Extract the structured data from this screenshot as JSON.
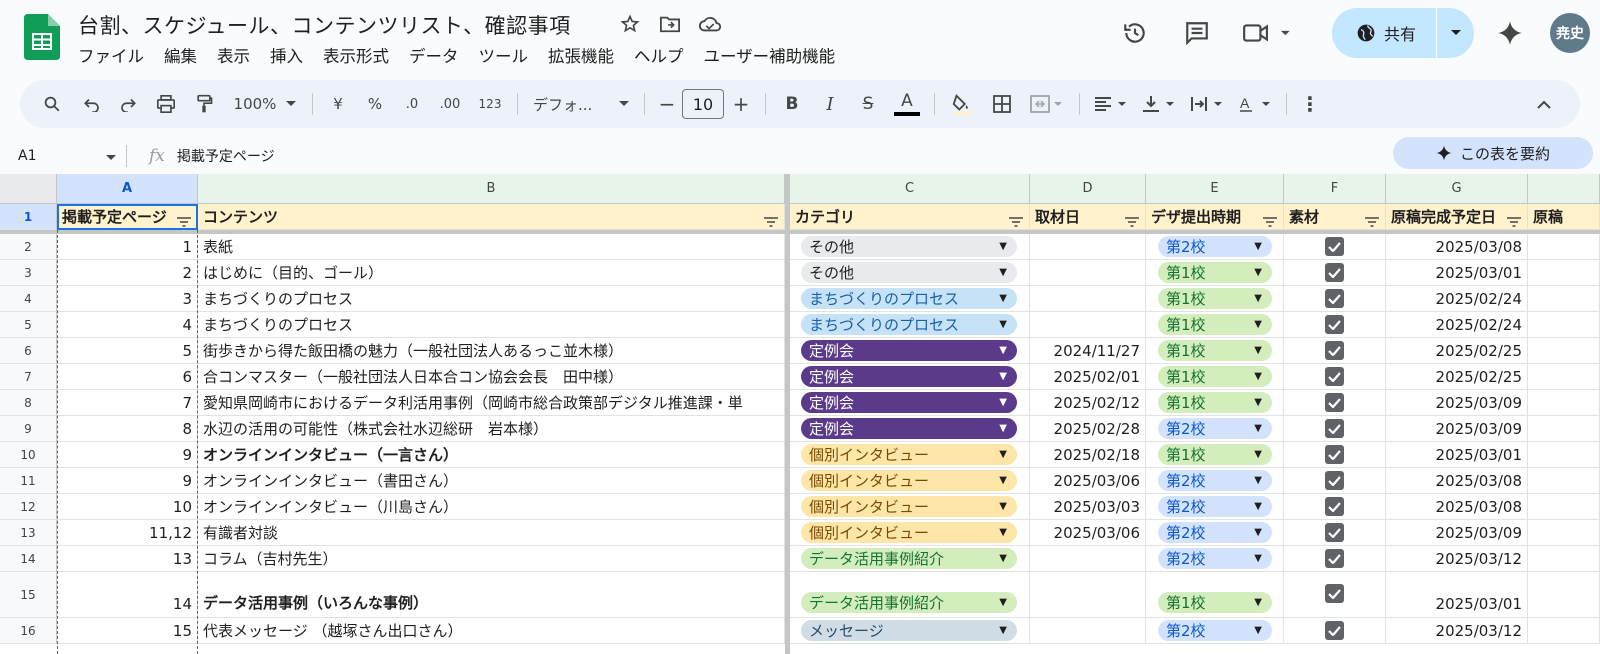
{
  "doc": {
    "title": "台割、スケジュール、コンテンツリスト、確認事項"
  },
  "menu": [
    "ファイル",
    "編集",
    "表示",
    "挿入",
    "表示形式",
    "データ",
    "ツール",
    "拡張機能",
    "ヘルプ",
    "ユーザー補助機能"
  ],
  "header_actions": {
    "share_label": "共有",
    "avatar_initials": "尭史"
  },
  "toolbar": {
    "zoom": "100%",
    "currency": "¥",
    "percent": "%",
    "dec_decrease": ".0",
    "dec_increase": ".00",
    "number_format": "123",
    "font": "デフォ...",
    "font_size": "10"
  },
  "formula_bar": {
    "cell_ref": "A1",
    "content": "掲載予定ページ",
    "summarize_label": "この表を要約"
  },
  "columns": [
    "A",
    "B",
    "C",
    "D",
    "E",
    "F",
    "G"
  ],
  "header_row": {
    "row_num": "1",
    "a": "掲載予定ページ",
    "b": "コンテンツ",
    "c": "カテゴリ",
    "d": "取材日",
    "e": "デザ提出時期",
    "f": "素材",
    "g": "原稿完成予定日",
    "h": "原稿"
  },
  "rows": [
    {
      "n": "2",
      "a": "1",
      "b": "表紙",
      "c": "その他",
      "d": "",
      "e": "第2校",
      "f": true,
      "g": "2025/03/08"
    },
    {
      "n": "3",
      "a": "2",
      "b": "はじめに（目的、ゴール）",
      "c": "その他",
      "d": "",
      "e": "第1校",
      "f": true,
      "g": "2025/03/01"
    },
    {
      "n": "4",
      "a": "3",
      "b": "まちづくりのプロセス",
      "c": "まちづくりのプロセス",
      "d": "",
      "e": "第1校",
      "f": true,
      "g": "2025/02/24"
    },
    {
      "n": "5",
      "a": "4",
      "b": "まちづくりのプロセス",
      "c": "まちづくりのプロセス",
      "d": "",
      "e": "第1校",
      "f": true,
      "g": "2025/02/24"
    },
    {
      "n": "6",
      "a": "5",
      "b": "街歩きから得た飯田橋の魅力（一般社団法人あるっこ並木様）",
      "c": "定例会",
      "d": "2024/11/27",
      "e": "第1校",
      "f": true,
      "g": "2025/02/25"
    },
    {
      "n": "7",
      "a": "6",
      "b": "合コンマスター（一般社団法人日本合コン協会会長　田中様）",
      "c": "定例会",
      "d": "2025/02/01",
      "e": "第1校",
      "f": true,
      "g": "2025/02/25"
    },
    {
      "n": "8",
      "a": "7",
      "b": "愛知県岡崎市におけるデータ利活用事例（岡崎市総合政策部デジタル推進課・単",
      "c": "定例会",
      "d": "2025/02/12",
      "e": "第1校",
      "f": true,
      "g": "2025/03/09"
    },
    {
      "n": "9",
      "a": "8",
      "b": "水辺の活用の可能性（株式会社水辺総研　岩本様）",
      "c": "定例会",
      "d": "2025/02/28",
      "e": "第2校",
      "f": true,
      "g": "2025/03/09"
    },
    {
      "n": "10",
      "a": "9",
      "b": "オンラインインタビュー（一言さん）",
      "bold": true,
      "c": "個別インタビュー",
      "d": "2025/02/18",
      "e": "第1校",
      "f": true,
      "g": "2025/03/01"
    },
    {
      "n": "11",
      "a": "9",
      "b": "オンラインインタビュー（書田さん）",
      "c": "個別インタビュー",
      "d": "2025/03/06",
      "e": "第2校",
      "f": true,
      "g": "2025/03/08"
    },
    {
      "n": "12",
      "a": "10",
      "b": "オンラインインタビュー（川島さん）",
      "c": "個別インタビュー",
      "d": "2025/03/03",
      "e": "第2校",
      "f": true,
      "g": "2025/03/08"
    },
    {
      "n": "13",
      "a": "11,12",
      "b": "有識者対談",
      "c": "個別インタビュー",
      "d": "2025/03/06",
      "e": "第2校",
      "f": true,
      "g": "2025/03/09"
    },
    {
      "n": "14",
      "a": "13",
      "b": "コラム（吉村先生）",
      "c": "データ活用事例紹介",
      "d": "",
      "e": "第2校",
      "f": true,
      "g": "2025/03/12"
    },
    {
      "n": "15",
      "a": "14",
      "b": "データ活用事例（いろんな事例）",
      "bold": true,
      "c": "データ活用事例紹介",
      "d": "",
      "e": "第1校",
      "f": true,
      "g": "2025/03/01",
      "tall": true
    },
    {
      "n": "16",
      "a": "15",
      "b": "代表メッセージ （越塚さん出口さん）",
      "c": "メッセージ",
      "d": "",
      "e": "第2校",
      "f": true,
      "g": "2025/03/12"
    }
  ],
  "chip_colors": {
    "その他": {
      "bg": "#e8eaed",
      "fg": "#1f1f1f"
    },
    "まちづくりのプロセス": {
      "bg": "#c6e2f7",
      "fg": "#1a5fa8"
    },
    "定例会": {
      "bg": "#5b3a8c",
      "fg": "#ffffff"
    },
    "個別インタビュー": {
      "bg": "#fde6a8",
      "fg": "#7a4a00"
    },
    "データ活用事例紹介": {
      "bg": "#d4edbc",
      "fg": "#137333"
    },
    "メッセージ": {
      "bg": "#d0dde6",
      "fg": "#2c4a63"
    },
    "第1校": {
      "bg": "#d4edbc",
      "fg": "#137333"
    },
    "第2校": {
      "bg": "#d3e3fd",
      "fg": "#0b57d0"
    }
  }
}
